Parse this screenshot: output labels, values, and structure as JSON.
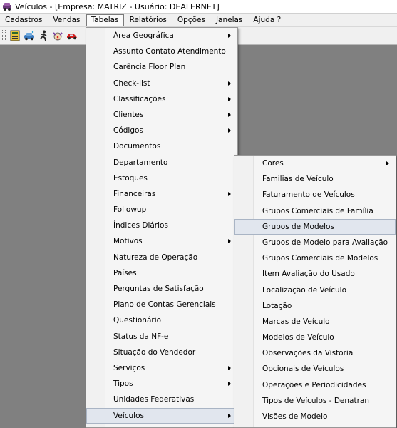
{
  "window": {
    "title": "Veículos - [Empresa: MATRIZ - Usuário: DEALERNET]"
  },
  "menubar": {
    "items": [
      {
        "label": "Cadastros"
      },
      {
        "label": "Vendas"
      },
      {
        "label": "Tabelas",
        "active": true
      },
      {
        "label": "Relatórios"
      },
      {
        "label": "Opções"
      },
      {
        "label": "Janelas"
      },
      {
        "label": "Ajuda ?"
      }
    ]
  },
  "toolbar": {
    "icons": [
      "calculator-icon",
      "car-wash-icon",
      "runner-icon",
      "clown-icon",
      "red-car-icon"
    ]
  },
  "tabelas_menu": {
    "items": [
      {
        "label": "Área Geográfica",
        "submenu": true
      },
      {
        "label": "Assunto Contato Atendimento",
        "submenu": false
      },
      {
        "label": "Carência Floor Plan",
        "submenu": false
      },
      {
        "label": "Check-list",
        "submenu": true
      },
      {
        "label": "Classificações",
        "submenu": true
      },
      {
        "label": "Clientes",
        "submenu": true
      },
      {
        "label": "Códigos",
        "submenu": true
      },
      {
        "label": "Documentos",
        "submenu": false
      },
      {
        "label": "Departamento",
        "submenu": false
      },
      {
        "label": "Estoques",
        "submenu": false
      },
      {
        "label": "Financeiras",
        "submenu": true
      },
      {
        "label": "Followup",
        "submenu": false
      },
      {
        "label": "Índices Diários",
        "submenu": false
      },
      {
        "label": "Motivos",
        "submenu": true
      },
      {
        "label": "Natureza de Operação",
        "submenu": false
      },
      {
        "label": "Países",
        "submenu": false
      },
      {
        "label": "Perguntas de Satisfação",
        "submenu": false
      },
      {
        "label": "Plano de Contas Gerenciais",
        "submenu": false
      },
      {
        "label": "Questionário",
        "submenu": false
      },
      {
        "label": "Status da NF-e",
        "submenu": false
      },
      {
        "label": "Situação do Vendedor",
        "submenu": false
      },
      {
        "label": "Serviços",
        "submenu": true
      },
      {
        "label": "Tipos",
        "submenu": true
      },
      {
        "label": "Unidades Federativas",
        "submenu": false
      },
      {
        "label": "Veículos",
        "submenu": true,
        "highlighted": true
      }
    ]
  },
  "veiculos_submenu": {
    "items": [
      {
        "label": "Cores",
        "submenu": true
      },
      {
        "label": "Familias de Veículo",
        "submenu": false
      },
      {
        "label": "Faturamento de Veículos",
        "submenu": false
      },
      {
        "label": "Grupos Comerciais de Família",
        "submenu": false
      },
      {
        "label": "Grupos de Modelos",
        "submenu": false,
        "highlighted": true
      },
      {
        "label": "Grupos de Modelo para Avaliação",
        "submenu": false
      },
      {
        "label": "Grupos Comerciais de Modelos",
        "submenu": false
      },
      {
        "label": "Item Avaliação do Usado",
        "submenu": false
      },
      {
        "label": "Localização de Veículo",
        "submenu": false
      },
      {
        "label": "Lotação",
        "submenu": false
      },
      {
        "label": "Marcas de Veículo",
        "submenu": false
      },
      {
        "label": "Modelos de Veículo",
        "submenu": false
      },
      {
        "label": "Observações da Vistoria",
        "submenu": false
      },
      {
        "label": "Opcionais de Veículos",
        "submenu": false
      },
      {
        "label": "Operações e Periodicidades",
        "submenu": false
      },
      {
        "label": "Tipos de Veículos - Denatran",
        "submenu": false
      },
      {
        "label": "Visões de Modelo",
        "submenu": false
      }
    ]
  },
  "colors": {
    "workspace": "#808080",
    "menu_bg": "#f5f5f5",
    "highlight": "#e1e6ee"
  }
}
